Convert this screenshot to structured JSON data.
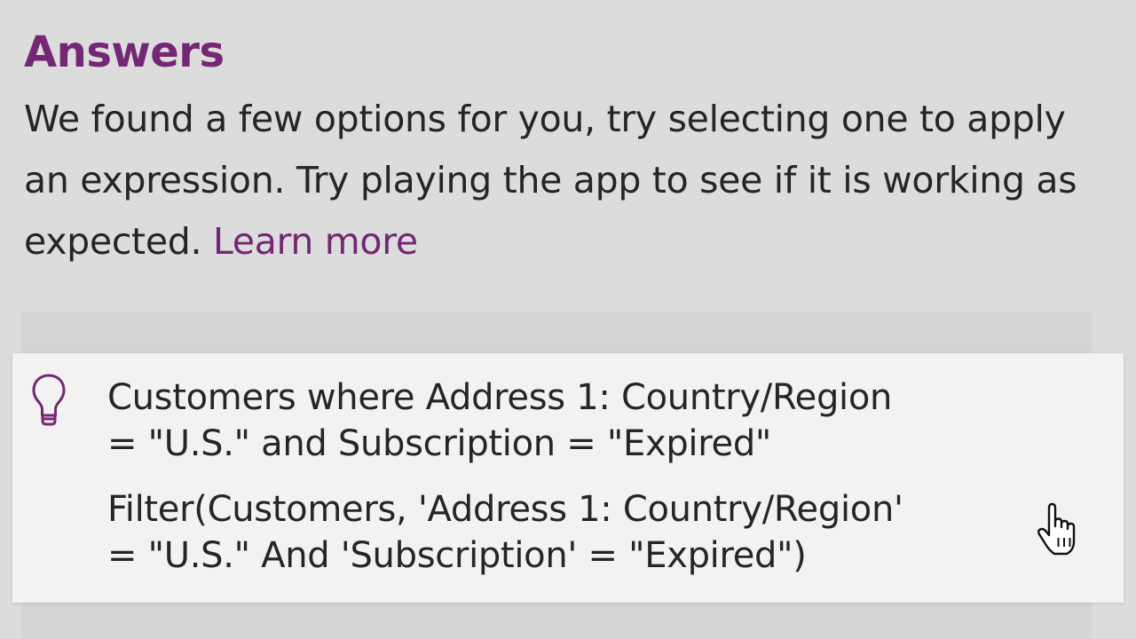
{
  "answers": {
    "heading": "Answers",
    "description_text": "We found a few options for you, try selecting one to apply an expression. Try playing the app to see if it is working as expected.",
    "learn_more_label": "Learn more"
  },
  "suggestion": {
    "icon": "lightbulb-icon",
    "description_line1": "Customers where Address 1: Country/Region",
    "description_line2": "= \"U.S.\" and Subscription = \"Expired\"",
    "formula_line1": "Filter(Customers, 'Address 1: Country/Region'",
    "formula_line2": "= \"U.S.\" And 'Subscription' = \"Expired\")"
  },
  "pointer": {
    "icon": "hand-pointer-cursor-icon"
  },
  "colors": {
    "accent": "#742774",
    "background": "#dcdcdc",
    "card": "#f2f2f1",
    "text": "#252525"
  }
}
